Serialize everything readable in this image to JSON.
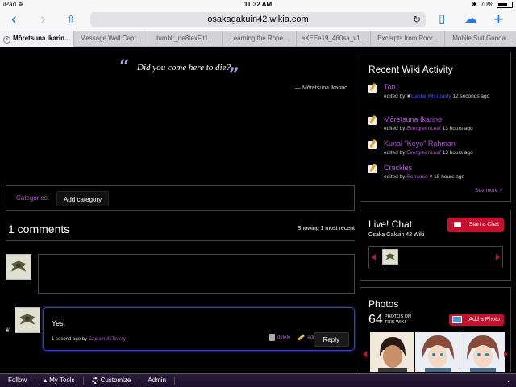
{
  "status": {
    "device": "iPad",
    "time": "11:32 AM",
    "battery": "70%",
    "battery_level": 0.7
  },
  "browser": {
    "url": "osakagakuin42.wikia.com",
    "tabs": [
      {
        "label": "Mōretsuna Ikarin..."
      },
      {
        "label": "Message Wall:Capt..."
      },
      {
        "label": "tumblr_ne8texFjt1..."
      },
      {
        "label": "Learning the Rope..."
      },
      {
        "label": "aXEEe19_460sa_v1..."
      },
      {
        "label": "Excerpts from Poor..."
      },
      {
        "label": "Mobile Suit Gunda..."
      }
    ]
  },
  "quote": {
    "text": "Did you come here to die?",
    "attribution": "— Mōretsuna Ikarino"
  },
  "categories": {
    "label": "Categories:",
    "add_label": "Add category"
  },
  "comments": {
    "heading": "1 comments",
    "showing": "Showing 1 most recent",
    "items": [
      {
        "text": "Yes.",
        "time": "1 second ago by",
        "user": "CaptainMcToasty",
        "delete_label": "delete",
        "edit_label": "edit",
        "reply_label": "Reply"
      }
    ]
  },
  "rail": {
    "activity": {
      "title": "Recent Wiki Activity",
      "items": [
        {
          "page": "Toru",
          "edited_by": "edited by",
          "user": "CaptainMcToasty",
          "when": "12 seconds ago"
        },
        {
          "page": "Mōretsuna Ikarino",
          "edited_by": "edited by",
          "user": "EvergreenLeaf",
          "when": "13 hours ago"
        },
        {
          "page": "Kunal \"Koyo\" Rahman",
          "edited_by": "edited by",
          "user": "EvergreenLeaf",
          "when": "13 hours ago"
        },
        {
          "page": "Crackles",
          "edited_by": "edited by",
          "user": "Remorse-9",
          "when": "15 hours ago"
        }
      ],
      "see_more": "See more >"
    },
    "chat": {
      "title": "Live! Chat",
      "subtitle": "Osaka Gakuin 42 Wiki",
      "start_label": "Start a Chat"
    },
    "photos": {
      "title": "Photos",
      "count": "64",
      "count_label": "PHOTOS ON THIS WIKI",
      "add_label": "Add a Photo"
    }
  },
  "toolbar": {
    "follow": "Follow",
    "my_tools": "My Tools",
    "customize": "Customize",
    "admin": "Admin"
  }
}
